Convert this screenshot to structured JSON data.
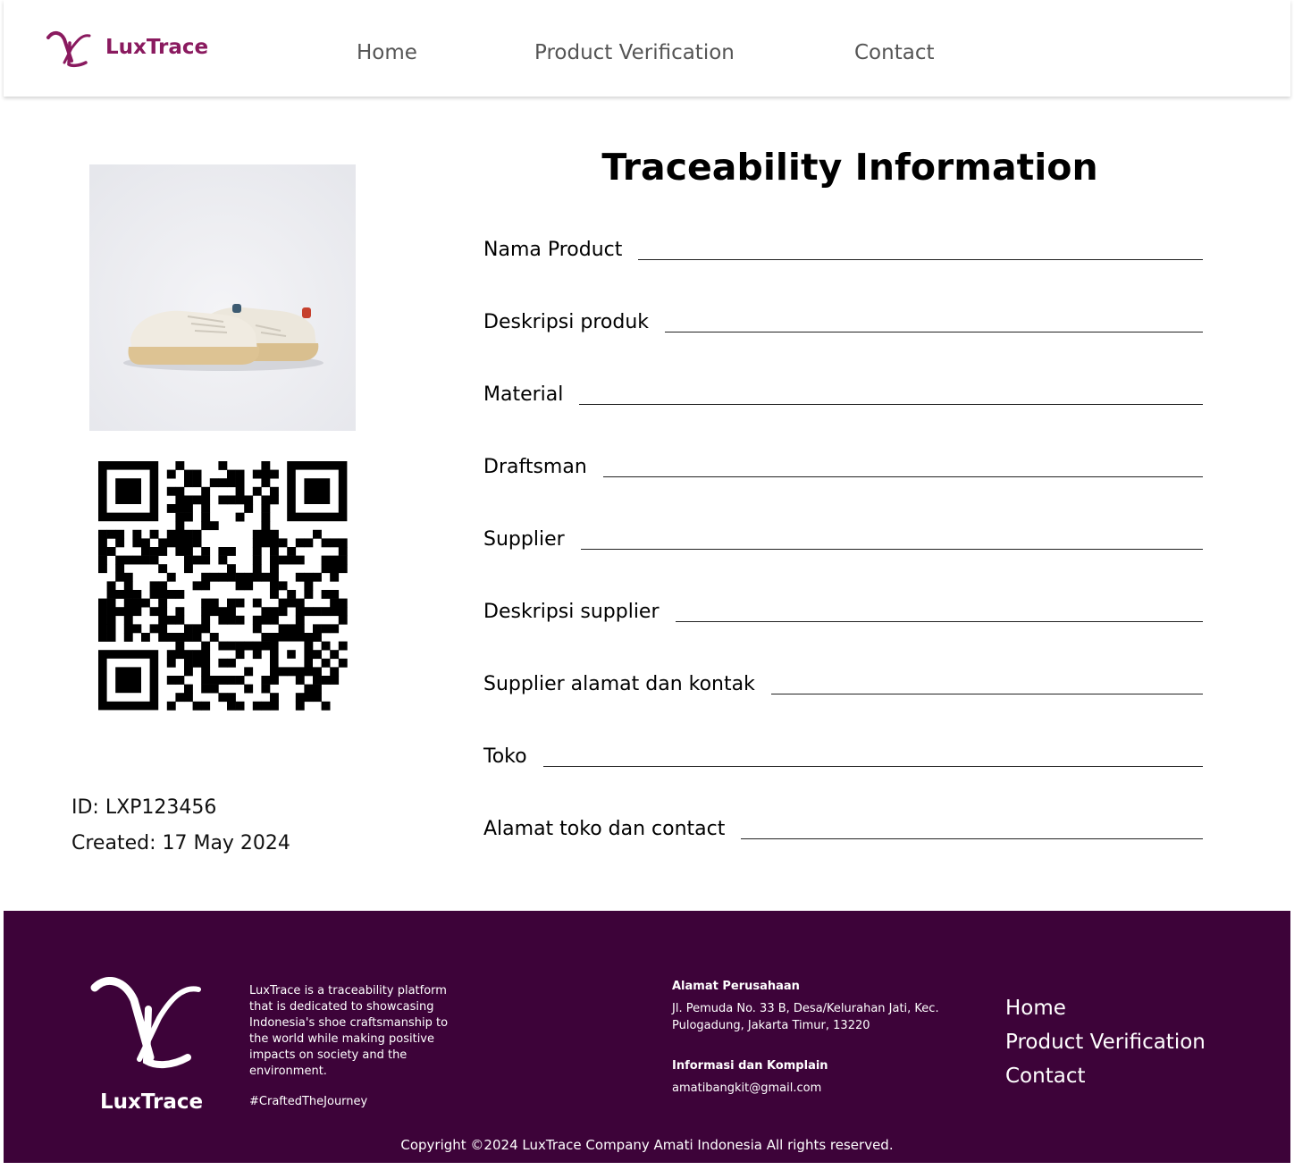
{
  "brand": {
    "name": "LuxTrace",
    "accent_color": "#8a1a5f",
    "footer_color": "#3d0339"
  },
  "nav": {
    "items": [
      "Home",
      "Product Verification",
      "Contact"
    ]
  },
  "product": {
    "image": "sneaker-photo",
    "qr_icon": "qr-code-icon",
    "id_line": "ID: LXP123456",
    "created_line": "Created: 17 May 2024"
  },
  "trace": {
    "title": "Traceability Information",
    "fields": [
      "Nama Product",
      "Deskripsi produk",
      "Material",
      "Draftsman",
      "Supplier",
      "Deskripsi supplier",
      "Supplier alamat dan kontak",
      "Toko",
      "Alamat toko dan contact"
    ]
  },
  "footer": {
    "brand": "LuxTrace",
    "description": "LuxTrace is a traceability platform that is dedicated to showcasing Indonesia's shoe craftsmanship to the world while making positive impacts on society and the environment.",
    "hashtag": "#CraftedTheJourney",
    "address_heading": "Alamat Perusahaan",
    "address": "Jl. Pemuda No. 33 B, Desa/Kelurahan Jati, Kec. Pulogadung, Jakarta Timur, 13220",
    "info_heading": "Informasi dan Komplain",
    "email": "amatibangkit@gmail.com",
    "nav": [
      "Home",
      "Product Verification",
      "Contact"
    ],
    "copyright": "Copyright ©2024 LuxTrace Company Amati Indonesia All rights reserved."
  }
}
